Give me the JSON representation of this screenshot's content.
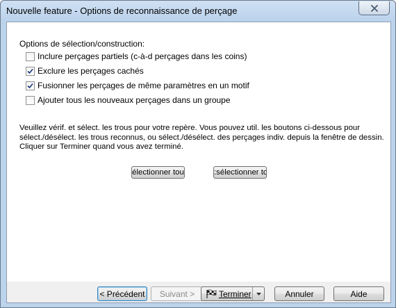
{
  "window": {
    "title": "Nouvelle feature - Options de reconnaissance de perçage"
  },
  "options": {
    "section_label": "Options de sélection/construction:",
    "items": [
      {
        "label": "Inclure perçages partiels (c-à-d perçages dans les coins)",
        "checked": false
      },
      {
        "label": "Exclure les perçages cachés",
        "checked": true
      },
      {
        "label": "Fusionner les perçages de même paramètres en un motif",
        "checked": true
      },
      {
        "label": "Ajouter tous les nouveaux perçages dans un groupe",
        "checked": false
      }
    ]
  },
  "instructions": {
    "line1": "Veuillez vérif. et sélect. les trous pour votre repère. Vous pouvez util. les boutons ci-dessous pour",
    "line2": "sélect./désélect. les trous reconnus, ou sélect./désélect. des perçages indiv. depuis la fenêtre de dessin.",
    "line3": "Cliquer sur Terminer quand vous avez terminé."
  },
  "selection_buttons": {
    "select_all": "électionner tou",
    "deselect_all": ":sélectionner to"
  },
  "footer": {
    "previous": "< Précédent",
    "next": "Suivant >",
    "finish": "Terminer",
    "cancel": "Annuler",
    "help": "Aide"
  }
}
